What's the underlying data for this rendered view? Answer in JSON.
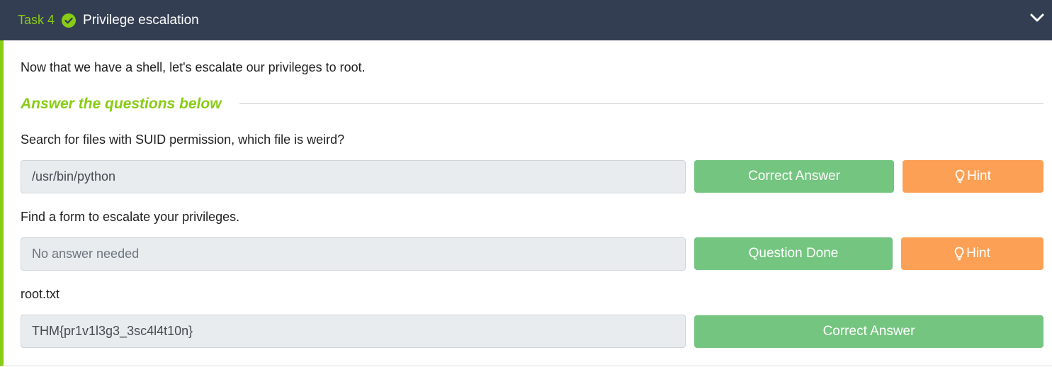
{
  "task": {
    "number_label": "Task 4",
    "title": "Privilege escalation",
    "intro": "Now that we have a shell, let's escalate our privileges to root."
  },
  "section": {
    "title": "Answer the questions below"
  },
  "questions": [
    {
      "text": "Search for files with SUID permission, which file is weird?",
      "answer": "/usr/bin/python",
      "status_button": "Correct Answer",
      "hint_button": "Hint"
    },
    {
      "text": "Find a form to escalate your privileges.",
      "answer": "No answer needed",
      "status_button": "Question Done",
      "hint_button": "Hint"
    },
    {
      "text": "root.txt",
      "answer": "THM{pr1v1l3g3_3sc4l4t10n}",
      "status_button": "Correct Answer"
    }
  ],
  "colors": {
    "header_bg": "#343e53",
    "accent_green": "#88cc14",
    "success_button": "#74c580",
    "hint_button": "#fba054"
  },
  "icons": {
    "completed": "check-circle-icon",
    "collapse": "chevron-down-icon",
    "hint": "lightbulb-icon"
  }
}
